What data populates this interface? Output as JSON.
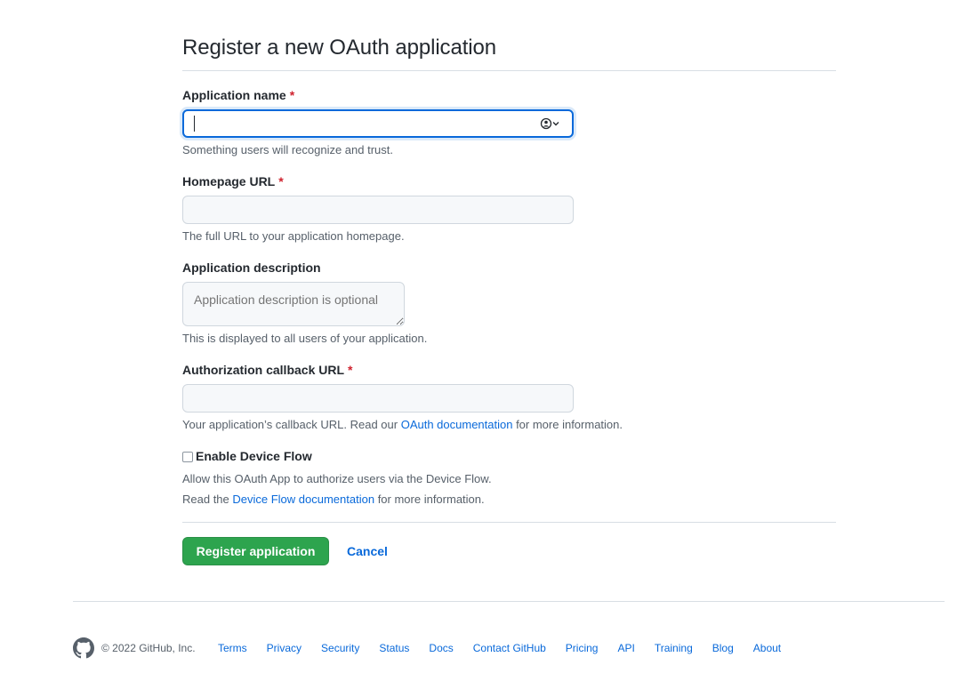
{
  "page_title": "Register a new OAuth application",
  "fields": {
    "app_name": {
      "label": "Application name",
      "required_mark": "*",
      "value": "",
      "note": "Something users will recognize and trust."
    },
    "homepage_url": {
      "label": "Homepage URL",
      "required_mark": "*",
      "value": "",
      "note": "The full URL to your application homepage."
    },
    "description": {
      "label": "Application description",
      "placeholder": "Application description is optional",
      "note": "This is displayed to all users of your application."
    },
    "callback_url": {
      "label": "Authorization callback URL",
      "required_mark": "*",
      "value": "",
      "note_before": "Your application’s callback URL. Read our ",
      "note_link": "OAuth documentation",
      "note_after": " for more information."
    }
  },
  "device_flow": {
    "label": "Enable Device Flow",
    "checked": false,
    "desc1": "Allow this OAuth App to authorize users via the Device Flow.",
    "desc2_before": "Read the ",
    "desc2_link": "Device Flow documentation",
    "desc2_after": " for more information."
  },
  "actions": {
    "register_label": "Register application",
    "cancel_label": "Cancel"
  },
  "footer": {
    "copyright": "© 2022 GitHub, Inc.",
    "links": [
      "Terms",
      "Privacy",
      "Security",
      "Status",
      "Docs",
      "Contact GitHub",
      "Pricing",
      "API",
      "Training",
      "Blog",
      "About"
    ]
  },
  "colors": {
    "accent": "#0969da",
    "primary_button": "#2da44e",
    "required": "#cf222e"
  }
}
